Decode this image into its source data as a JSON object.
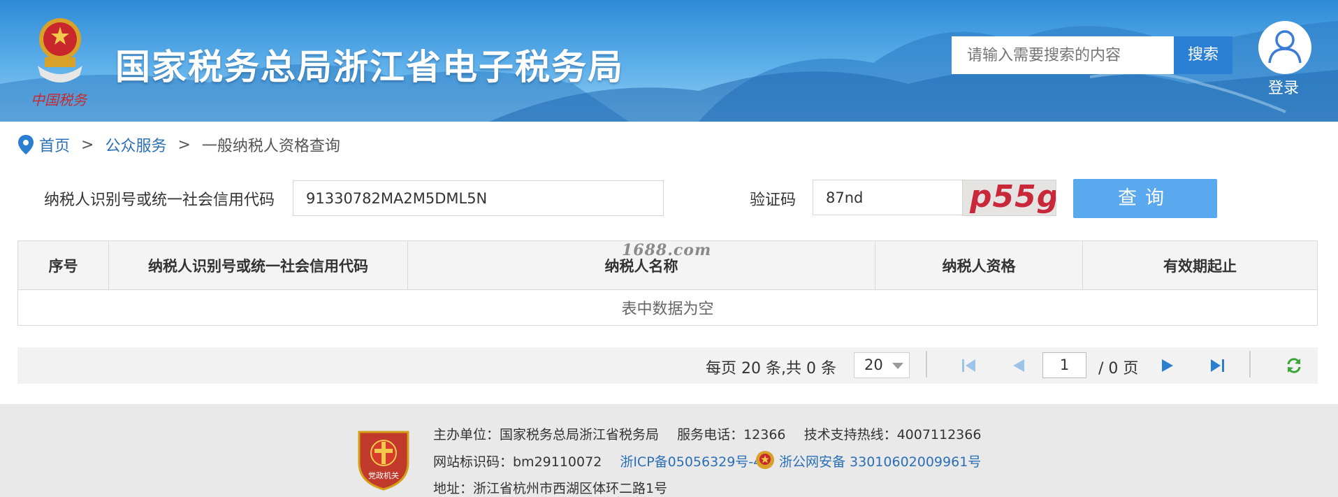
{
  "header": {
    "site_title": "国家税务总局浙江省电子税务局",
    "emblem_caption": "中国税务",
    "search_placeholder": "请输入需要搜索的内容",
    "search_button": "搜索",
    "login_label": "登录"
  },
  "breadcrumb": {
    "home": "首页",
    "sep1": ">",
    "public": "公众服务",
    "sep2": ">",
    "current": "一般纳税人资格查询"
  },
  "form": {
    "code_label": "纳税人识别号或统一社会信用代码",
    "code_value": "91330782MA2M5DML5N",
    "captcha_label": "验证码",
    "captcha_value": "87nd",
    "captcha_image_text": "p55g",
    "query_button": "查询"
  },
  "table": {
    "columns": [
      "序号",
      "纳税人识别号或统一社会信用代码",
      "纳税人名称",
      "纳税人资格",
      "有效期起止"
    ],
    "empty_text": "表中数据为空"
  },
  "watermark": "1688.com",
  "pager": {
    "info": "每页 20 条,共 0 条",
    "page_size": "20",
    "current_page": "1",
    "total_pages": "/ 0 页"
  },
  "footer": {
    "line1_sponsor": "主办单位：国家税务总局浙江省税务局",
    "line1_phone": "服务电话：12366",
    "line1_hotline": "技术支持热线：4007112366",
    "line2_site_id": "网站标识码：bm29110072",
    "line2_icp": "浙ICP备05056329号-4",
    "line2_police": "浙公网安备 33010602009961号",
    "line3_address": "地址：浙江省杭州市西湖区体环二路1号",
    "badge_text": "党政机关"
  },
  "colors": {
    "header_blue": "#2f8bd6",
    "link_blue": "#2b6fb6",
    "query_button": "#5aa8ed",
    "search_button": "#2b80d5"
  }
}
